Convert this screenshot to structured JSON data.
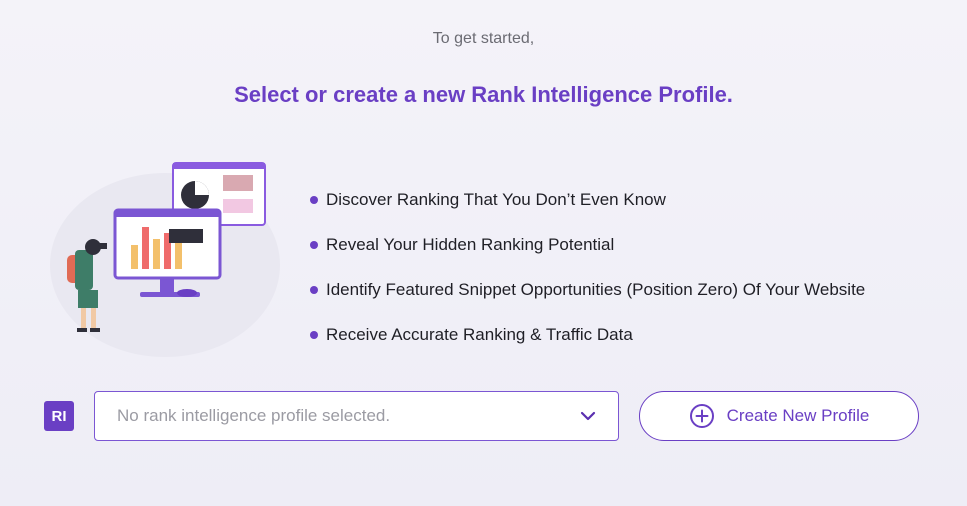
{
  "intro": {
    "text": "To get started,"
  },
  "headline": {
    "text": "Select or create a new Rank Intelligence Profile."
  },
  "features": [
    "Discover Ranking That You Don’t Even Know",
    "Reveal Your Hidden Ranking Potential",
    "Identify Featured Snippet Opportunities (Position Zero) Of Your Website",
    "Receive Accurate Ranking & Traffic Data"
  ],
  "badge": {
    "text": "RI"
  },
  "profile_select": {
    "value": "No rank intelligence profile selected.",
    "icon": "chevron-down-icon"
  },
  "create_button": {
    "label": "Create New Profile",
    "icon": "plus-circle-icon"
  },
  "colors": {
    "accent": "#6a3fc4",
    "text": "#1f1f26",
    "muted": "#6b6b73",
    "background": "#f2f1f8"
  }
}
